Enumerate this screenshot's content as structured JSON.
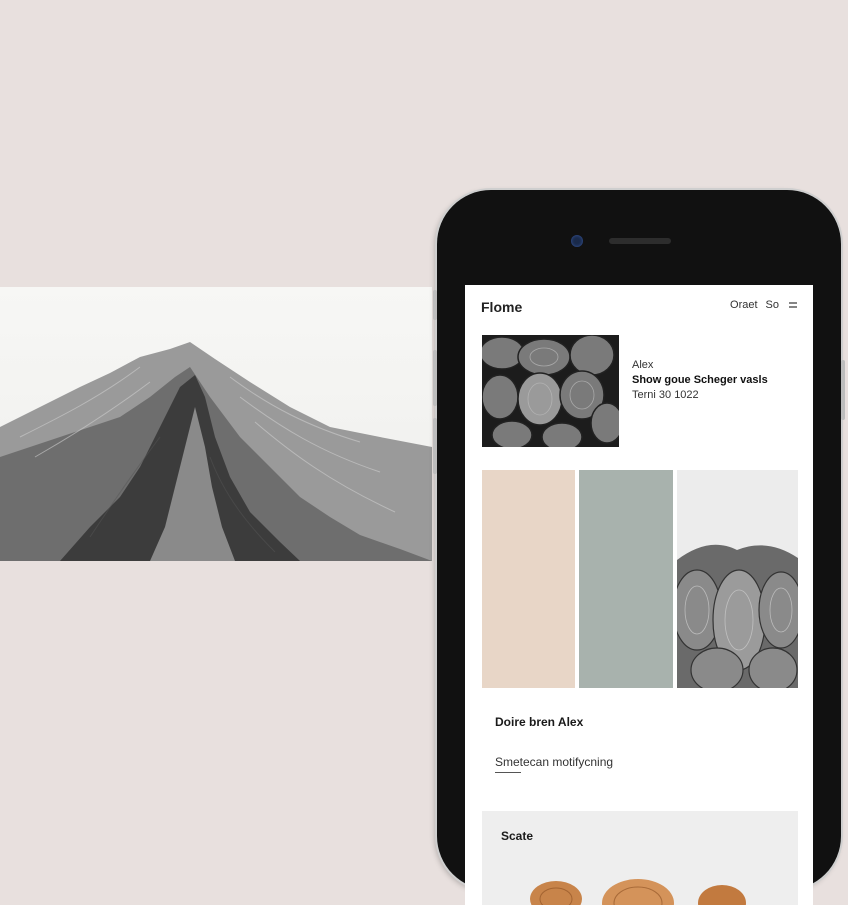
{
  "app": {
    "title": "Flome",
    "actions": [
      "Oraet",
      "So"
    ]
  },
  "profile": {
    "name": "Alex",
    "description": "Show goue Scheger vasls",
    "date": "Terni 30 1022"
  },
  "palette": {
    "colors": [
      "#e8d6c7",
      "#a8b2ad"
    ]
  },
  "section": {
    "title": "Doire bren Alex",
    "subtitle": "Smetecan motifycning"
  },
  "bottom": {
    "label": "Scate"
  }
}
